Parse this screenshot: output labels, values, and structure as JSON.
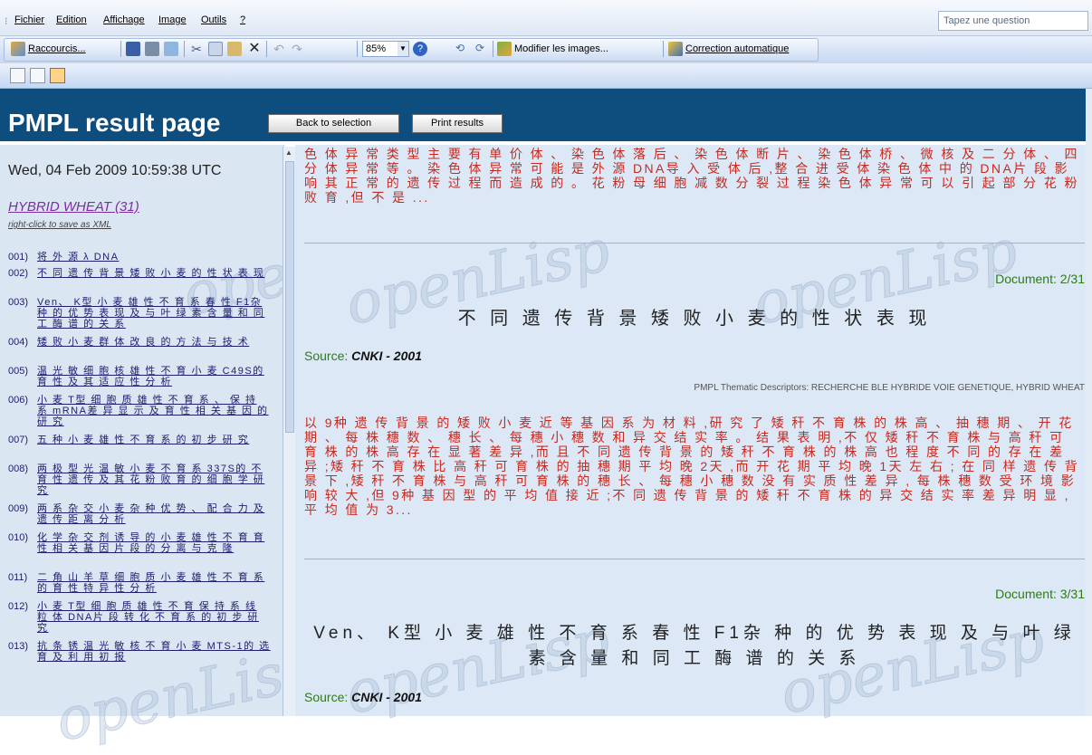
{
  "menubar": {
    "items": [
      "Fichier",
      "Edition",
      "Affichage",
      "Image",
      "Outils",
      "?"
    ],
    "question_placeholder": "Tapez une question"
  },
  "toolbar": {
    "shortcuts_label": "Raccourcis...",
    "zoom": "85%",
    "modify_images_label": "Modifier les images...",
    "autocorrect_label": "Correction automatique"
  },
  "header": {
    "title": "PMPL result page",
    "back_button": "Back to selection",
    "print_button": "Print results"
  },
  "watermark": "openLisp",
  "sidebar": {
    "date": "Wed, 04 Feb 2009 10:59:38 UTC",
    "topic": "HYBRID WHEAT (31)",
    "save_hint": "right-click to save as XML",
    "items": [
      {
        "num": "001)",
        "text": "将 外 源 λ DNA"
      },
      {
        "num": "002)",
        "text": "不 同 遗 传 背 景 矮 败 小 麦 的 性 状 表 现"
      },
      {
        "num": "003)",
        "text": "Ven、 K型 小 麦 雄 性 不 育 系 春 性 F1杂 种 的 优 势 表 现 及 与 叶 绿 素 含 量 和 同 工 酶 谱 的 关 系"
      },
      {
        "num": "004)",
        "text": "矮 败 小 麦 群 体 改 良 的 方 法 与 技 术"
      },
      {
        "num": "005)",
        "text": "温 光 敏 细 胞 核 雄 性 不 育 小 麦 C49S的 育 性 及 其 适 应 性 分 析"
      },
      {
        "num": "006)",
        "text": "小 麦 T型 细 胞 质 雄 性 不 育 系 、 保 持 系 mRNA差 异 显 示 及 育 性 相 关 基 因 的 研 究"
      },
      {
        "num": "007)",
        "text": "五 种 小 麦 雄 性 不 育 系 的 初 步 研 究"
      },
      {
        "num": "008)",
        "text": "两 极 型 光 温 敏 小 麦 不 育 系 337S的 不 育 性 遗 传 及 其 花 粉 败 育 的 细 胞 学 研 究"
      },
      {
        "num": "009)",
        "text": "两 系 杂 交 小 麦 杂 种 优 势 、 配 合 力 及 遗 传 距 离 分 析"
      },
      {
        "num": "010)",
        "text": "化 学 杂 交 剂 诱 导 的 小 麦 雄 性 不 育 育 性 相 关 基 因 片 段 的 分 离 与 克 隆"
      },
      {
        "num": "011)",
        "text": "二 角 山 羊 草 细 胞 质 小 麦 雄 性 不 育 系 的 育 性 特 异 性 分 析"
      },
      {
        "num": "012)",
        "text": "小 麦 T型 细 胞 质 雄 性 不 育 保 持 系 线 粒 体 DNA片 段 转 化 不 育 系 的 初 步 研 究"
      },
      {
        "num": "013)",
        "text": "抗 条 锈 温 光 敏 核 不 育 小 麦 MTS-1的 选 育 及 利 用 初 报"
      }
    ]
  },
  "main": {
    "doc1_tail": "色 体 异 常 类 型 主 要 有 单 价 体 、 染 色 体 落 后 、 染 色 体 断 片 、 染 色 体 桥 、 微 核 及 二 分 体 、 四 分 体 异 常 等 。 染 色 体 异 常 可 能 是 外 源 DNA导 入 受 体 后 ,整 合 进 受 体 染 色 体 中 的 DNA片 段 影 响 其 正 常 的 遗 传 过 程 而 造 成 的 。 花 粉 母 细 胞 减 数 分 裂 过 程 染 色 体 异 常 可 以 引 起 部 分 花 粉 败 育 ,但 不 是 ...",
    "doc2": {
      "number": "Document: 2/31",
      "title": "不 同 遗 传 背 景 矮 败 小 麦 的 性 状 表 现",
      "source_label": "Source:",
      "source_value": "CNKI - 2001",
      "descriptors": "PMPL Thematic Descriptors: RECHERCHE BLE HYBRIDE VOIE GENETIQUE, HYBRID WHEAT",
      "abstract": "以 9种 遗 传 背 景 的 矮 败 小 麦 近 等 基 因 系 为 材 料 ,研 究 了 矮 秆 不 育 株 的 株 高 、 抽 穗 期 、 开 花 期 、 每 株 穗 数 、 穗 长 、 每 穗 小 穗 数 和 异 交 结 实 率 。 结 果 表 明 ,不 仅 矮 秆 不 育 株 与 高 秆 可 育 株 的 株 高 存 在 显 著 差 异 ,而 且 不 同 遗 传 背 景 的 矮 秆 不 育 株 的 株 高 也 程 度 不 同 的 存 在 差 异 ;矮 秆 不 育 株 比 高 秆 可 育 株 的 抽 穗 期 平 均 晚 2天 ,而 开 花 期 平 均 晚 1天 左 右 ; 在 同 样 遗 传 背 景 下 ,矮 秆 不 育 株 与 高 秆 可 育 株 的 穗 长 、 每 穗 小 穗 数 没 有 实 质 性 差 异 , 每 株 穗 数 受 环 境 影 响 较 大 ,但 9种 基 因 型 的 平 均 值 接 近 ;不 同 遗 传 背 景 的 矮 秆 不 育 株 的 异 交 结 实 率 差 异 明 显 ,平 均 值 为 3..."
    },
    "doc3": {
      "number": "Document: 3/31",
      "title": "Ven、 K型 小 麦 雄 性 不 育 系 春 性 F1杂 种 的 优 势 表 现 及 与 叶 绿 素 含 量 和 同 工 酶 谱 的 关 系",
      "source_label": "Source:",
      "source_value": "CNKI - 2001"
    }
  }
}
